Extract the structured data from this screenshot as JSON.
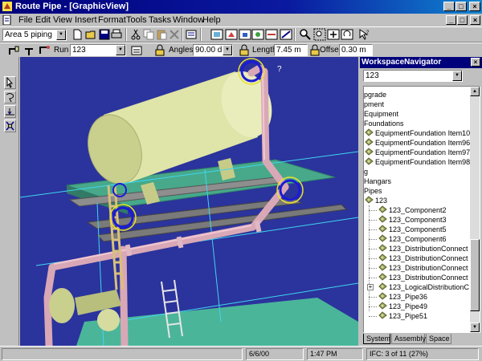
{
  "window": {
    "title": "Route Pipe - [GraphicView]",
    "controls": [
      "_",
      "□",
      "×"
    ]
  },
  "menu": {
    "items": [
      "File",
      "Edit",
      "View",
      "Insert",
      "Format",
      "Tools",
      "Tasks",
      "Window",
      "Help"
    ],
    "mdi_controls": [
      "_",
      "□",
      "×"
    ]
  },
  "toolbar": {
    "filter_select": "Area 5 piping",
    "buttons": [
      "new-icon",
      "open-icon",
      "save-icon",
      "print-icon",
      "cut-icon",
      "copy-icon",
      "paste-icon",
      "delete-icon",
      "properties-icon",
      "view-icon",
      "zoom-icon"
    ]
  },
  "ribbon": {
    "run_label": "Run",
    "run_value": "123",
    "angles_label": "Angles",
    "angles_value": "90.00 de",
    "length_label": "Length",
    "length_value": "7.45 m",
    "offset_label": "Offset",
    "offset_value": "0.30 m"
  },
  "viewport": {
    "annotation": "?"
  },
  "navigator": {
    "title": "WorkspaceNavigator",
    "selected": "123",
    "tree": [
      {
        "label": "pgrade",
        "indent": 0,
        "icon": ""
      },
      {
        "label": "pment",
        "indent": 0,
        "icon": ""
      },
      {
        "label": "Equipment",
        "indent": 0,
        "icon": ""
      },
      {
        "label": "Foundations",
        "indent": 0,
        "icon": ""
      },
      {
        "label": "EquipmentFoundation Item10",
        "indent": 1,
        "icon": "foundation-icon"
      },
      {
        "label": "EquipmentFoundation Item96",
        "indent": 1,
        "icon": "foundation-icon"
      },
      {
        "label": "EquipmentFoundation Item97",
        "indent": 1,
        "icon": "foundation-icon"
      },
      {
        "label": "EquipmentFoundation Item98",
        "indent": 1,
        "icon": "foundation-icon"
      },
      {
        "label": "g",
        "indent": 0,
        "icon": ""
      },
      {
        "label": "Hangars",
        "indent": 0,
        "icon": ""
      },
      {
        "label": "Pipes",
        "indent": 0,
        "icon": ""
      },
      {
        "label": "123",
        "indent": 1,
        "icon": "pipe-run-icon"
      },
      {
        "label": "123_Component2",
        "indent": 2,
        "icon": "component-icon"
      },
      {
        "label": "123_Component3",
        "indent": 2,
        "icon": "component-icon"
      },
      {
        "label": "123_Component5",
        "indent": 2,
        "icon": "component-icon"
      },
      {
        "label": "123_Component6",
        "indent": 2,
        "icon": "component-icon"
      },
      {
        "label": "123_DistributionConnect",
        "indent": 2,
        "icon": "component-icon"
      },
      {
        "label": "123_DistributionConnect",
        "indent": 2,
        "icon": "component-icon"
      },
      {
        "label": "123_DistributionConnect",
        "indent": 2,
        "icon": "component-icon"
      },
      {
        "label": "123_DistributionConnect",
        "indent": 2,
        "icon": "component-icon"
      },
      {
        "label": "123_LogicalDistributionC",
        "indent": 2,
        "icon": "component-icon",
        "expander": "+"
      },
      {
        "label": "123_Pipe36",
        "indent": 2,
        "icon": "component-icon"
      },
      {
        "label": "123_Pipe49",
        "indent": 2,
        "icon": "component-icon"
      },
      {
        "label": "123_Pipe51",
        "indent": 2,
        "icon": "component-icon"
      }
    ],
    "tabs": [
      "System",
      "Assembly",
      "Space"
    ]
  },
  "status": {
    "message": "",
    "date": "6/6/00",
    "time": "1:47 PM",
    "ifc": "IFC: 3 of 11 (27%)"
  },
  "colors": {
    "viewport_bg": "#2b339c",
    "equipment": "#d6dca0",
    "pipe": "#d6a6b2",
    "platform": "#48a08a",
    "selection": "#3fd6ef"
  }
}
